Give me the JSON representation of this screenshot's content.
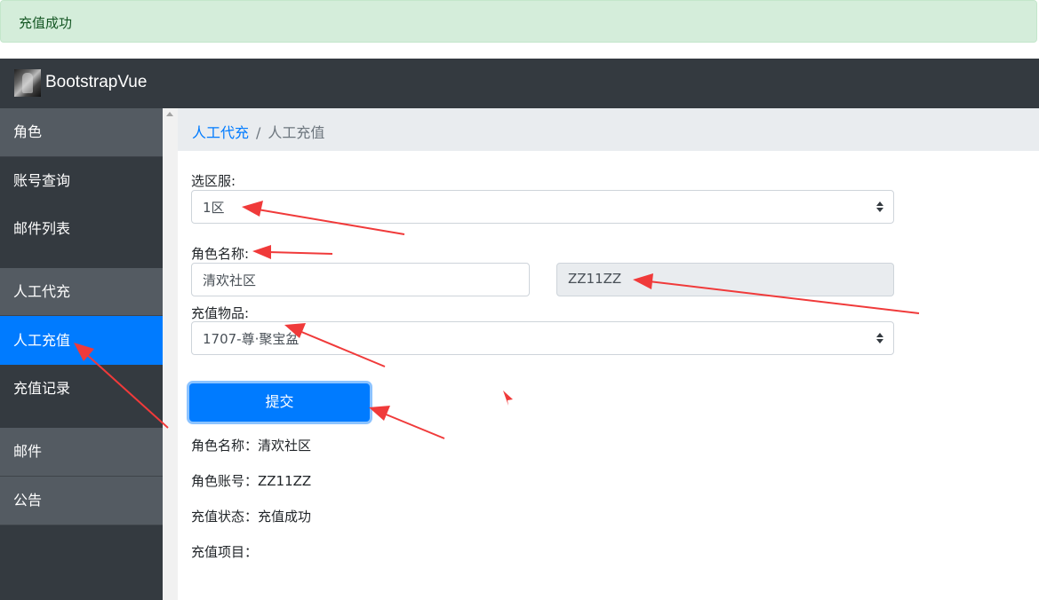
{
  "alert": {
    "text": "充值成功"
  },
  "navbar": {
    "brand": "BootstrapVue"
  },
  "sidebar": {
    "items": [
      {
        "label": "角色"
      },
      {
        "label": "账号查询"
      },
      {
        "label": "邮件列表"
      },
      {
        "label": "人工代充"
      },
      {
        "label": "人工充值"
      },
      {
        "label": "充值记录"
      },
      {
        "label": "邮件"
      },
      {
        "label": "公告"
      }
    ]
  },
  "breadcrumb": {
    "parent": "人工代充",
    "separator": "/",
    "current": "人工充值"
  },
  "form": {
    "server_label": "选区服:",
    "server_value": "1区",
    "role_label": "角色名称:",
    "role_name_value": "清欢社区",
    "account_value": "ZZ11ZZ",
    "item_label": "充值物品:",
    "item_value": "1707-尊·聚宝盆",
    "submit_label": "提交"
  },
  "result": {
    "role_name": "角色名称：清欢社区",
    "account": "角色账号：ZZ11ZZ",
    "status": "充值状态：充值成功",
    "items": "充值项目："
  },
  "colors": {
    "primary": "#007bff",
    "dark": "#343a40",
    "success_bg": "#d4edda",
    "annotation_arrow": "#f03a3a"
  }
}
